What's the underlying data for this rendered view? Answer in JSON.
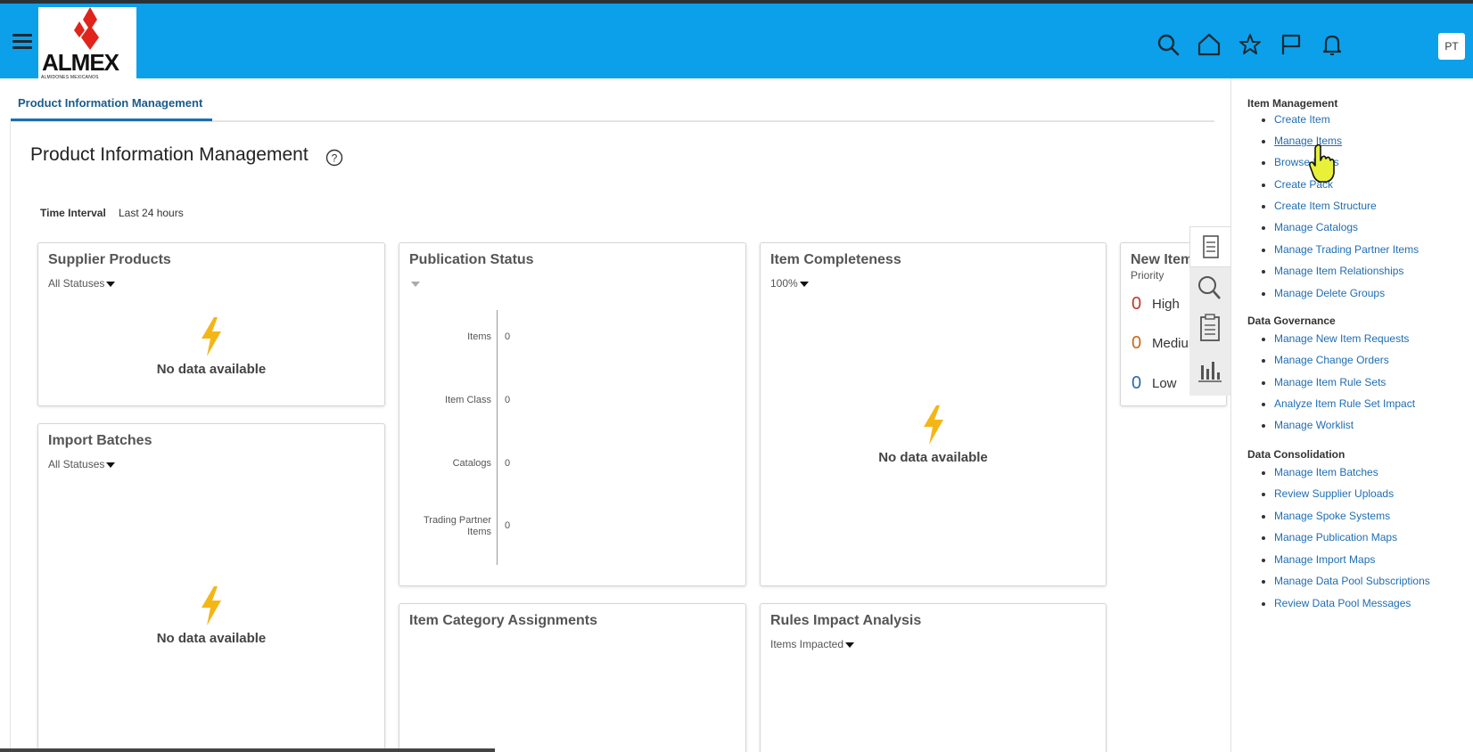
{
  "app": {
    "logo_text": "ALMEX",
    "logo_subtext": "ALMIDONES MEXICANOS",
    "avatar_initials": "PT",
    "header_icons": [
      "search-icon",
      "home-icon",
      "star-icon",
      "flag-icon",
      "bell-icon"
    ],
    "brand_color": "#0ca0ea"
  },
  "tabs": [
    {
      "label": "Product Information Management"
    }
  ],
  "page": {
    "title": "Product Information Management",
    "time_interval_label": "Time Interval",
    "time_interval_value": "Last 24 hours"
  },
  "cards": {
    "supplier_products": {
      "title": "Supplier Products",
      "filter": "All Statuses",
      "empty": "No data available"
    },
    "import_batches": {
      "title": "Import Batches",
      "filter": "All Statuses",
      "empty": "No data available"
    },
    "publication_status": {
      "title": "Publication Status",
      "rows": [
        {
          "label": "Items",
          "value": "0"
        },
        {
          "label": "Item Class",
          "value": "0"
        },
        {
          "label": "Catalogs",
          "value": "0"
        },
        {
          "label": "Trading Partner Items",
          "value": "0"
        }
      ]
    },
    "item_completeness": {
      "title": "Item Completeness",
      "filter": "100%",
      "empty": "No data available"
    },
    "new_items": {
      "title": "New Items",
      "subtitle": "Priority",
      "rows": [
        {
          "count": "0",
          "label": "High",
          "color": "#c0392b"
        },
        {
          "count": "0",
          "label": "Medium",
          "color": "#c86a1a"
        },
        {
          "count": "0",
          "label": "Low",
          "color": "#2b6aa6"
        }
      ]
    },
    "item_category_assignments": {
      "title": "Item Category Assignments"
    },
    "rules_impact_analysis": {
      "title": "Rules Impact Analysis",
      "filter": "Items Impacted"
    }
  },
  "side_tools": [
    "tasks-icon",
    "search-icon",
    "clipboard-icon",
    "bar-chart-icon"
  ],
  "task_panel": {
    "groups": [
      {
        "title": "Item Management",
        "links": [
          "Create Item",
          "Manage Items",
          "Browse Items",
          "Create Pack",
          "Create Item Structure",
          "Manage Catalogs",
          "Manage Trading Partner Items",
          "Manage Item Relationships",
          "Manage Delete Groups"
        ]
      },
      {
        "title": "Data Governance",
        "links": [
          "Manage New Item Requests",
          "Manage Change Orders",
          "Manage Item Rule Sets",
          "Analyze Item Rule Set Impact",
          "Manage Worklist"
        ]
      },
      {
        "title": "Data Consolidation",
        "links": [
          "Manage Item Batches",
          "Review Supplier Uploads",
          "Manage Spoke Systems",
          "Manage Publication Maps",
          "Manage Import Maps",
          "Manage Data Pool Subscriptions",
          "Review Data Pool Messages"
        ]
      }
    ]
  }
}
